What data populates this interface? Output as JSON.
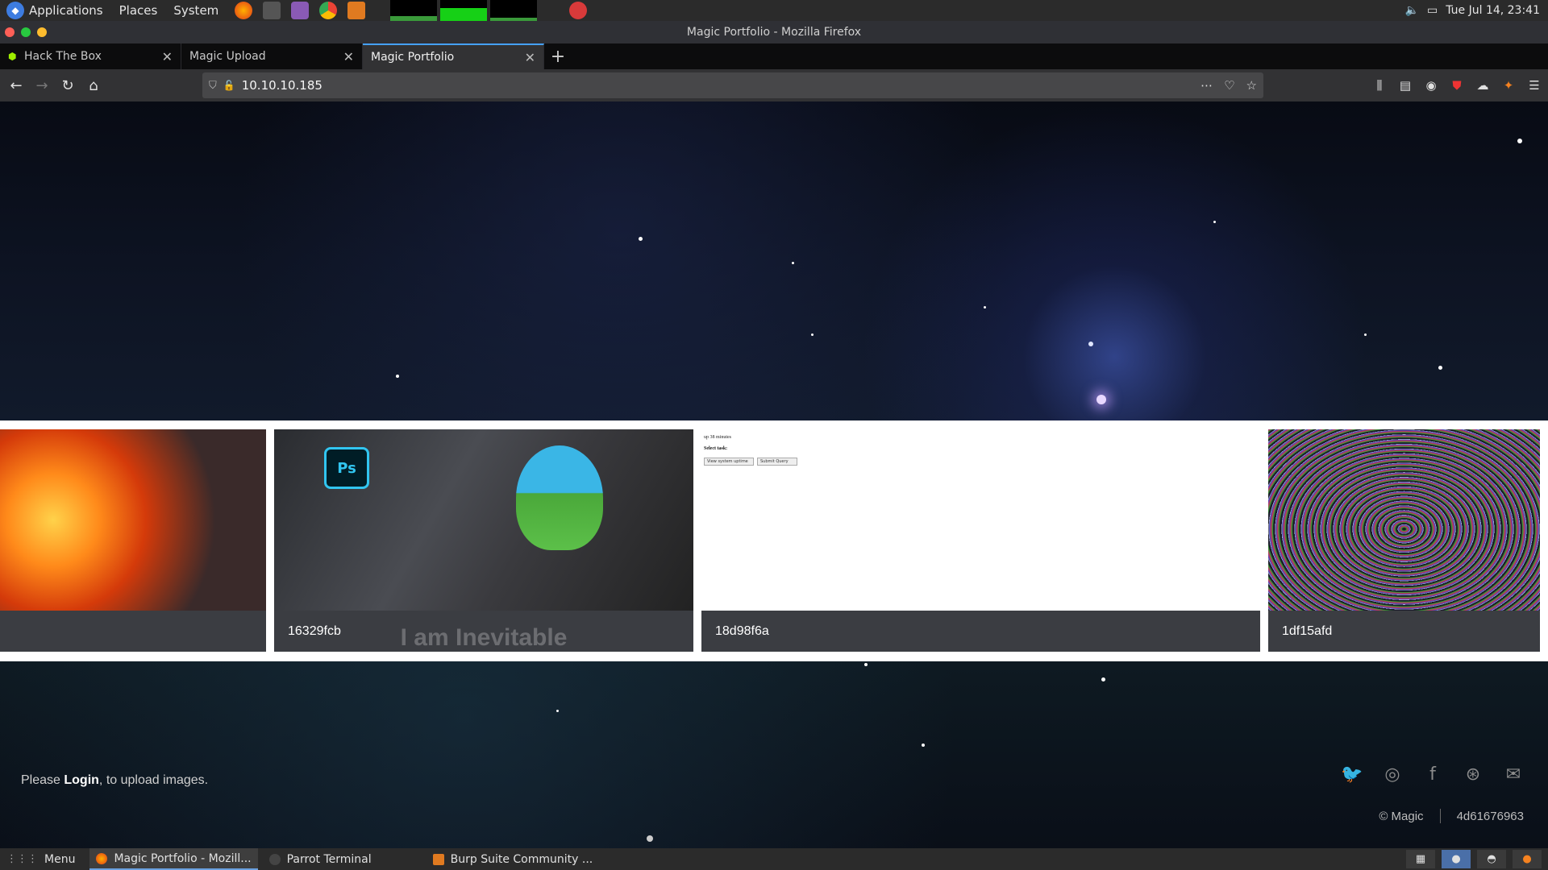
{
  "system_panel": {
    "menus": [
      "Applications",
      "Places",
      "System"
    ],
    "clock": "Tue Jul 14, 23:41"
  },
  "window": {
    "title": "Magic Portfolio - Mozilla Firefox"
  },
  "tabs": [
    {
      "label": "Hack The Box"
    },
    {
      "label": "Magic Upload"
    },
    {
      "label": "Magic Portfolio"
    }
  ],
  "urlbar": {
    "url": "10.10.10.185"
  },
  "gallery": {
    "cards": [
      {
        "caption": ""
      },
      {
        "caption": "16329fcb",
        "overlay_text": "I am Inevitable"
      },
      {
        "caption": "18d98f6a",
        "mini_uptime": "up 38 minutes",
        "mini_task_label": "Select task:",
        "mini_select": "View system uptime",
        "mini_button": "Submit Query"
      },
      {
        "caption": "1df15afd"
      }
    ]
  },
  "footer": {
    "login_prefix": "Please ",
    "login_link": "Login",
    "login_suffix": ", to upload images.",
    "copyright": "© Magic",
    "hash": "4d61676963"
  },
  "taskbar": {
    "menu": "Menu",
    "items": [
      "Magic Portfolio - Mozill...",
      "Parrot Terminal",
      "Burp Suite Community ..."
    ]
  },
  "colors": {
    "accent": "#45a1ff",
    "htb_green": "#9fef00"
  }
}
